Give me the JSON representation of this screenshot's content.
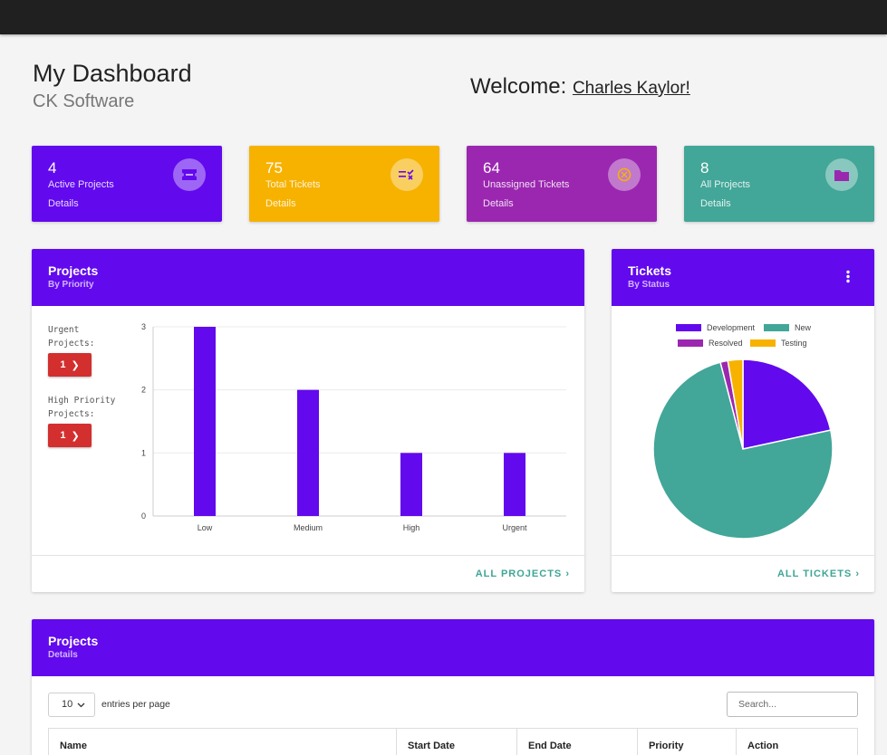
{
  "header": {
    "title": "My Dashboard",
    "company": "CK Software",
    "welcome_label": "Welcome:",
    "user_name": "Charles Kaylor!"
  },
  "stats": [
    {
      "value": "4",
      "label": "Active Projects",
      "details": "Details",
      "color": "#6209ee",
      "icon": "ticket-icon"
    },
    {
      "value": "75",
      "label": "Total Tickets",
      "details": "Details",
      "color": "#f7b200",
      "icon": "checklist-icon"
    },
    {
      "value": "64",
      "label": "Unassigned Tickets",
      "details": "Details",
      "color": "#9b27b0",
      "icon": "unassigned-icon"
    },
    {
      "value": "8",
      "label": "All Projects",
      "details": "Details",
      "color": "#42a698",
      "icon": "folder-icon"
    }
  ],
  "projects_card": {
    "title": "Projects",
    "subtitle": "By Priority",
    "urgent_label": "Urgent Projects:",
    "urgent_count": "1",
    "high_label": "High Priority Projects:",
    "high_count": "1",
    "footer_link": "ALL PROJECTS"
  },
  "tickets_card": {
    "title": "Tickets",
    "subtitle": "By Status",
    "footer_link": "ALL TICKETS"
  },
  "table_card": {
    "title": "Projects",
    "subtitle": "Details",
    "page_size": "10",
    "entries_label": "entries per page",
    "search_placeholder": "Search...",
    "columns": [
      "Name",
      "Start Date",
      "End Date",
      "Priority",
      "Action"
    ]
  },
  "chart_data": [
    {
      "type": "bar",
      "categories": [
        "Low",
        "Medium",
        "High",
        "Urgent"
      ],
      "values": [
        3,
        2,
        1,
        1
      ],
      "ylim": [
        0,
        3
      ],
      "yticks": [
        0,
        1,
        2,
        3
      ],
      "color": "#6209ee",
      "grid": true
    },
    {
      "type": "pie",
      "labels": [
        "Development",
        "New",
        "Resolved",
        "Testing"
      ],
      "values": [
        16,
        55,
        1,
        2
      ],
      "colors": [
        "#6209ee",
        "#42a698",
        "#9b27b0",
        "#f7b200"
      ],
      "legend": "top"
    }
  ]
}
